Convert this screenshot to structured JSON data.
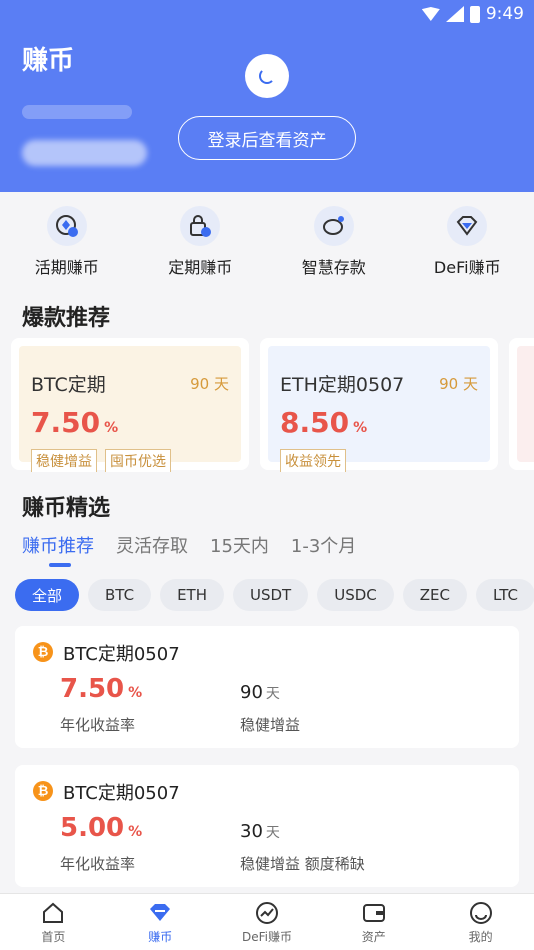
{
  "status": {
    "time": "9:49"
  },
  "header": {
    "title": "赚币",
    "login_label": "登录后查看资产"
  },
  "menu": [
    {
      "label": "活期赚币",
      "icon": "coin-icon"
    },
    {
      "label": "定期赚币",
      "icon": "lock-clock-icon"
    },
    {
      "label": "智慧存款",
      "icon": "piggy-bank-icon"
    },
    {
      "label": "DeFi赚币",
      "icon": "diamond-icon"
    }
  ],
  "hot": {
    "title": "爆款推荐",
    "cards": [
      {
        "name": "BTC定期",
        "days": "90 天",
        "rate": "7.50",
        "unit": "%",
        "tags": [
          "稳健增益",
          "囤币优选"
        ]
      },
      {
        "name": "ETH定期0507",
        "days": "90 天",
        "rate": "8.50",
        "unit": "%",
        "tags": [
          "收益领先"
        ]
      }
    ]
  },
  "select": {
    "title": "赚币精选",
    "tabs": [
      "赚币推荐",
      "灵活存取",
      "15天内",
      "1-3个月"
    ],
    "chips": [
      "全部",
      "BTC",
      "ETH",
      "USDT",
      "USDC",
      "ZEC",
      "LTC"
    ]
  },
  "products": [
    {
      "coin": "₿",
      "name": "BTC定期0507",
      "rate": "7.50",
      "unit": "%",
      "rate_label": "年化收益率",
      "days": "90",
      "days_unit": "天",
      "tags": "稳健增益"
    },
    {
      "coin": "₿",
      "name": "BTC定期0507",
      "rate": "5.00",
      "unit": "%",
      "rate_label": "年化收益率",
      "days": "30",
      "days_unit": "天",
      "tags": "稳健增益 额度稀缺"
    }
  ],
  "nav": [
    {
      "label": "首页",
      "icon": "home-icon"
    },
    {
      "label": "赚币",
      "icon": "earn-icon"
    },
    {
      "label": "DeFi赚币",
      "icon": "defi-icon"
    },
    {
      "label": "资产",
      "icon": "wallet-icon"
    },
    {
      "label": "我的",
      "icon": "profile-icon"
    }
  ],
  "colors": {
    "primary": "#3b6cf0",
    "hero": "#5a7ef4",
    "rate": "#e8554a",
    "tag": "#c8903c"
  }
}
